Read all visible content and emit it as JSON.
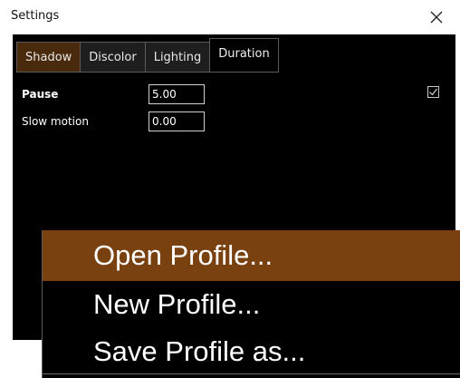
{
  "window": {
    "title": "Settings"
  },
  "tabs": [
    {
      "label": "Shadow"
    },
    {
      "label": "Discolor"
    },
    {
      "label": "Lighting"
    },
    {
      "label": "Duration"
    }
  ],
  "fields": {
    "pause": {
      "label": "Pause",
      "value": "5.00"
    },
    "slow_motion": {
      "label": "Slow motion",
      "value": "0.00"
    }
  },
  "checkbox": {
    "checked": true
  },
  "context_menu": {
    "items": [
      {
        "label": "Open Profile..."
      },
      {
        "label": "New Profile..."
      },
      {
        "label": "Save Profile as..."
      }
    ]
  },
  "colors": {
    "panel_bg": "#000000",
    "tab_active": "#4a2a0c",
    "menu_highlight": "#7a4110"
  },
  "icons": {
    "close": "close-icon",
    "check": "checkmark-icon"
  }
}
